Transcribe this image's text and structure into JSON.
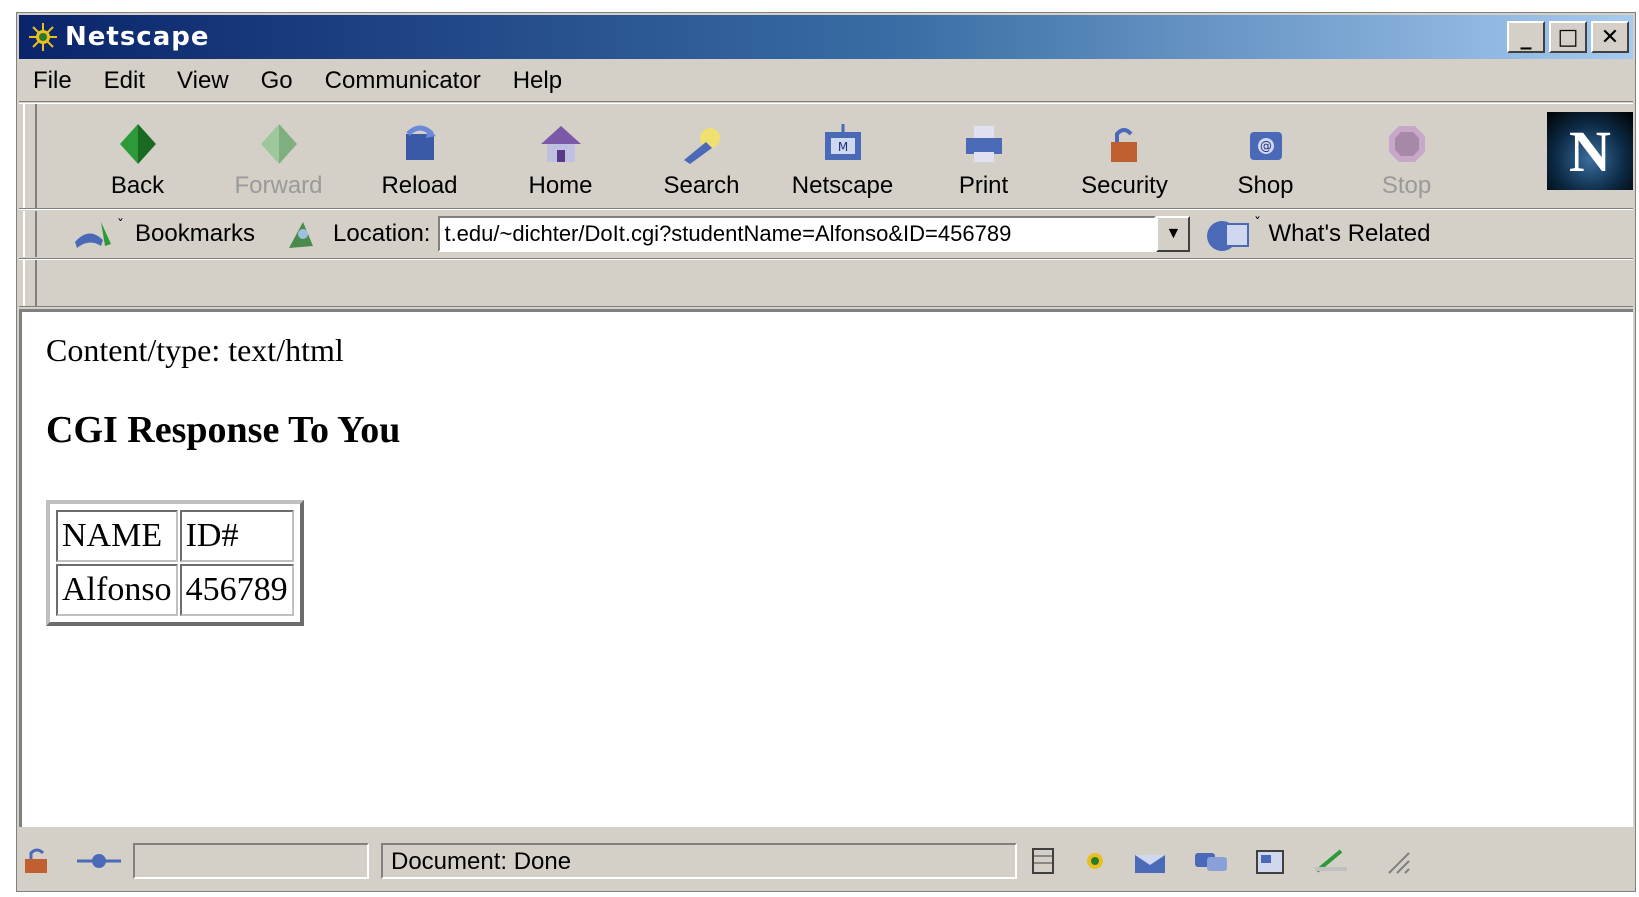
{
  "window": {
    "title": "Netscape",
    "controls": [
      "minimize",
      "maximize",
      "close"
    ]
  },
  "menu": [
    "File",
    "Edit",
    "View",
    "Go",
    "Communicator",
    "Help"
  ],
  "toolbar": {
    "buttons": [
      {
        "label": "Back",
        "icon": "back-arrow-icon",
        "enabled": true
      },
      {
        "label": "Forward",
        "icon": "forward-arrow-icon",
        "enabled": false
      },
      {
        "label": "Reload",
        "icon": "reload-icon",
        "enabled": true
      },
      {
        "label": "Home",
        "icon": "home-icon",
        "enabled": true
      },
      {
        "label": "Search",
        "icon": "search-icon",
        "enabled": true
      },
      {
        "label": "Netscape",
        "icon": "netscape-icon",
        "enabled": true
      },
      {
        "label": "Print",
        "icon": "printer-icon",
        "enabled": true
      },
      {
        "label": "Security",
        "icon": "lock-icon",
        "enabled": true
      },
      {
        "label": "Shop",
        "icon": "shop-icon",
        "enabled": true
      },
      {
        "label": "Stop",
        "icon": "stop-icon",
        "enabled": false
      }
    ],
    "logo_letter": "N"
  },
  "location": {
    "bookmarks_label": "Bookmarks",
    "location_label": "Location:",
    "url": "t.edu/~dichter/DoIt.cgi?studentName=Alfonso&ID=456789",
    "whats_related_label": "What's Related"
  },
  "page": {
    "content_type_line": "Content/type: text/html",
    "heading": "CGI Response To You",
    "table": {
      "headers": [
        "NAME",
        "ID#"
      ],
      "rows": [
        [
          "Alfonso",
          "456789"
        ]
      ]
    }
  },
  "status": {
    "text": "Document: Done"
  },
  "colors": {
    "titlebar_start": "#0a246a",
    "titlebar_end": "#a6caf0",
    "chrome": "#d4d0c8",
    "page_bg": "#ffffff"
  }
}
